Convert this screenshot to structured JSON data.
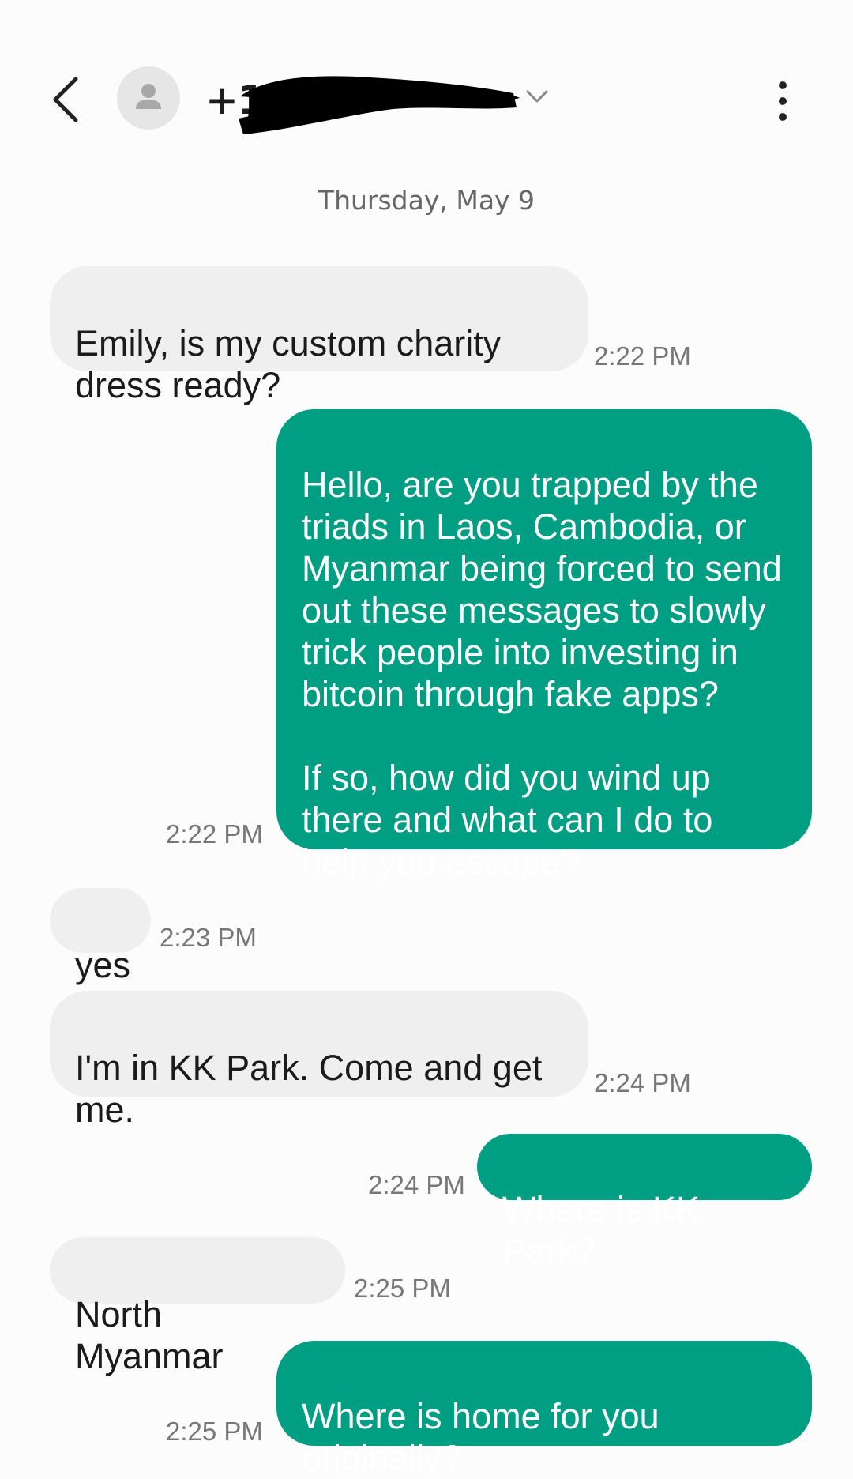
{
  "header": {
    "back_icon": "chevron-left-icon",
    "avatar_icon": "person-icon",
    "contact_number": "+16",
    "dropdown_icon": "chevron-down-icon",
    "menu_icon": "more-vertical-icon"
  },
  "conversation": {
    "date_label": "Thursday, May 9",
    "messages": [
      {
        "direction": "incoming",
        "text": "Emily, is my custom charity dress ready?",
        "time": "2:22 PM"
      },
      {
        "direction": "outgoing",
        "text": "Hello, are you trapped by the triads in Laos, Cambodia, or Myanmar being forced to send out these messages to slowly trick people into investing in bitcoin through fake apps?\n\nIf so, how did you wind up there and what can I do to help you escape?",
        "time": "2:22 PM"
      },
      {
        "direction": "incoming",
        "text": "yes",
        "time": "2:23 PM"
      },
      {
        "direction": "incoming",
        "text": "I'm in KK Park. Come and get me.",
        "time": "2:24 PM"
      },
      {
        "direction": "outgoing",
        "text": "Where is KK Park?",
        "time": "2:24 PM"
      },
      {
        "direction": "incoming",
        "text": "North Myanmar",
        "time": "2:25 PM"
      },
      {
        "direction": "outgoing",
        "text": "Where is home for you originally?",
        "time": "2:25 PM"
      }
    ]
  },
  "colors": {
    "outgoing_bubble": "#009e83",
    "incoming_bubble": "#efefef",
    "redaction": "#000000"
  }
}
